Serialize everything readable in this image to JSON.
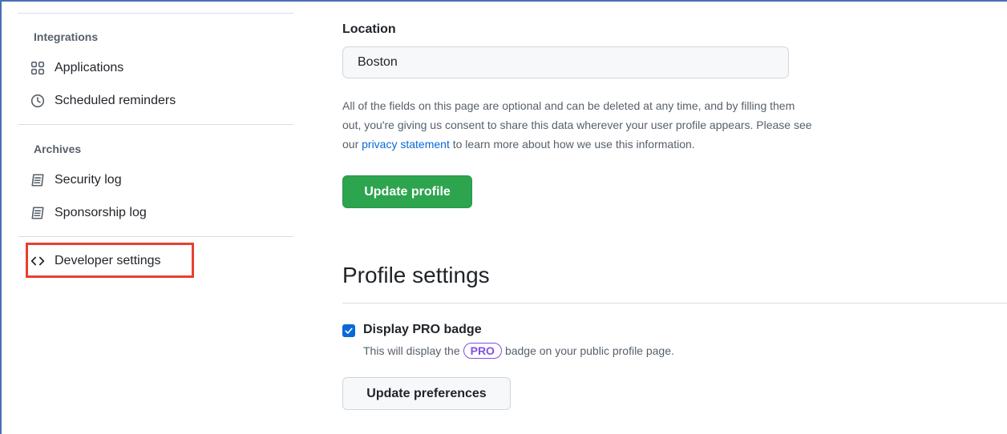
{
  "sidebar": {
    "sections": [
      {
        "heading": "Integrations",
        "items": [
          {
            "label": "Applications",
            "icon": "apps-icon"
          },
          {
            "label": "Scheduled reminders",
            "icon": "clock-icon"
          }
        ]
      },
      {
        "heading": "Archives",
        "items": [
          {
            "label": "Security log",
            "icon": "log-icon"
          },
          {
            "label": "Sponsorship log",
            "icon": "log-icon"
          }
        ]
      }
    ],
    "developer": {
      "label": "Developer settings",
      "icon": "code-icon"
    }
  },
  "main": {
    "location": {
      "label": "Location",
      "value": "Boston"
    },
    "note": {
      "before": "All of the fields on this page are optional and can be deleted at any time, and by filling them out, you're giving us consent to share this data wherever your user profile appears. Please see our ",
      "link": "privacy statement",
      "after": " to learn more about how we use this information."
    },
    "update_profile_label": "Update profile",
    "profile_settings": {
      "heading": "Profile settings",
      "checkbox_label": "Display PRO badge",
      "checked": true,
      "note_before": "This will display the",
      "badge": "PRO",
      "note_after": "badge on your public profile page.",
      "update_preferences_label": "Update preferences"
    }
  },
  "colors": {
    "primary": "#2da44e",
    "link": "#0969da",
    "highlight": "#e8402f",
    "pro": "#8250df"
  }
}
